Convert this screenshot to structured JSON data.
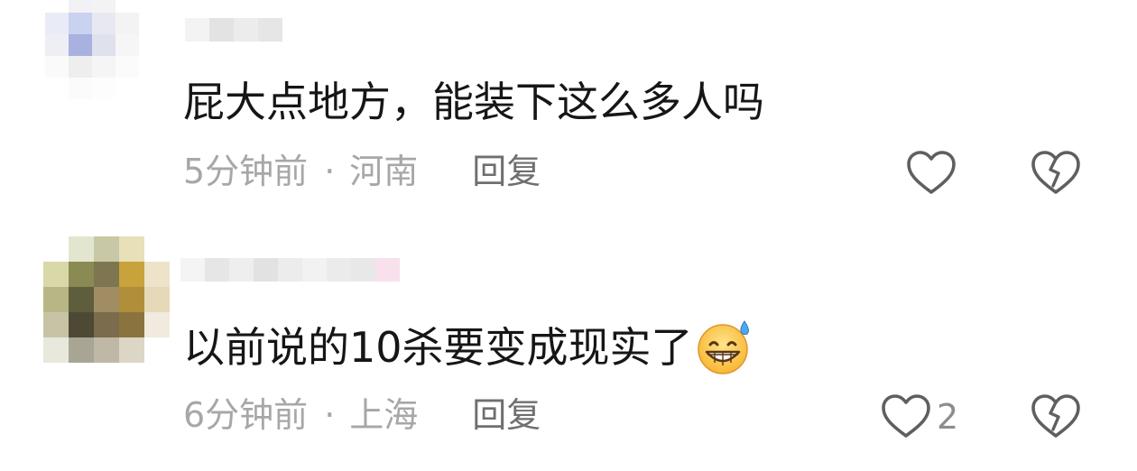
{
  "comments": [
    {
      "text": "屁大点地方，能装下这么多人吗",
      "time": "5分钟前",
      "separator": "·",
      "location": "河南",
      "reply_label": "回复",
      "like_count": "",
      "avatar_colors": [
        "#ffffff",
        "#f2f2f6",
        "#f3f3f6",
        "#ffffff",
        "#ffffff",
        "#e9ecf6",
        "#c9d2ee",
        "#e8e9f0",
        "#f3f3f3",
        "#ffffff",
        "#eeeef5",
        "#a8b1e0",
        "#dfe1ec",
        "#f6f6f6",
        "#ffffff",
        "#fafafa",
        "#eeeeee",
        "#f5f5f5",
        "#fbfbfb",
        "#ffffff",
        "#ffffff",
        "#fbfbfb",
        "#fdfdfd",
        "#ffffff",
        "#ffffff"
      ],
      "username_colors": [
        "#f3f3f3",
        "#e3e3e3",
        "#ececec",
        "#e6e6e6"
      ]
    },
    {
      "text": "以前说的10杀要变成现实了",
      "time": "6分钟前",
      "separator": "·",
      "location": "上海",
      "reply_label": "回复",
      "like_count": "2",
      "emoji": "grinning-sweat-emoji",
      "avatar_colors": [
        "#ffffff",
        "#e3e6cf",
        "#c8c8a6",
        "#e7e0b9",
        "#ffffff",
        "#d9d8a8",
        "#8a8a55",
        "#7d7650",
        "#c8a23b",
        "#ede3c8",
        "#b8b684",
        "#5f5e3c",
        "#a08d64",
        "#b08f3a",
        "#e6d9b8",
        "#c6c4a4",
        "#4d4935",
        "#7a6c4c",
        "#8b7340",
        "#f0ebde",
        "#e9e8dc",
        "#a9a595",
        "#bfb8a6",
        "#dcd6c7",
        "#ffffff"
      ],
      "username_colors": [
        "#f4f4f4",
        "#e6e6e6",
        "#eeeeee",
        "#e2e2e2",
        "#ececec",
        "#f2f2f2",
        "#ebebeb",
        "#e8e8e8",
        "#f8e1ec"
      ]
    }
  ],
  "colors": {
    "text": "#161616",
    "meta": "#a7a7a7",
    "reply": "#6f6f6f",
    "icon": "#5f5f5f"
  }
}
